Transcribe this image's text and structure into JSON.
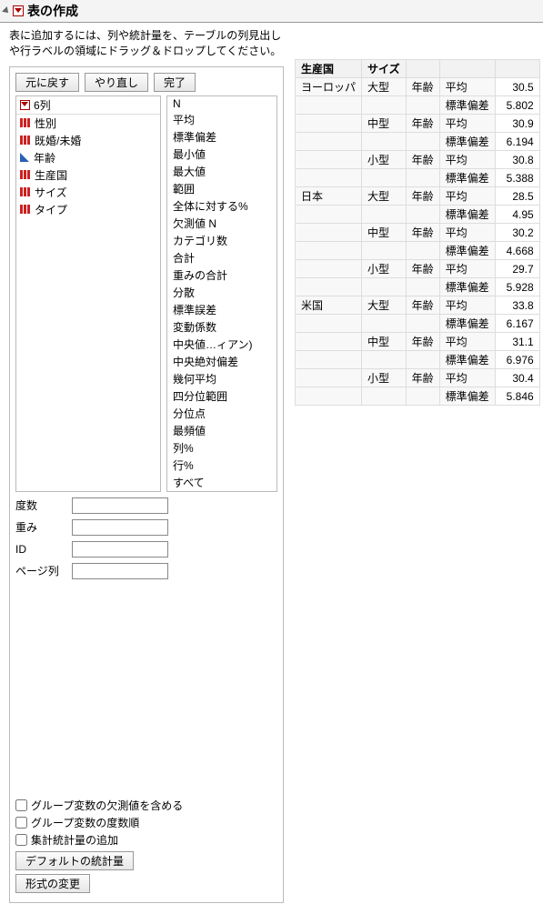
{
  "title": "表の作成",
  "instruction": "表に追加するには、列や統計量を、テーブルの列見出しや行ラベルの領域にドラッグ＆ドロップしてください。",
  "buttons": {
    "undo": "元に戻す",
    "redo": "やり直し",
    "done": "完了"
  },
  "col_count_label": "6列",
  "columns": [
    {
      "name": "性別",
      "type": "nom"
    },
    {
      "name": "既婚/未婚",
      "type": "nom"
    },
    {
      "name": "年齢",
      "type": "cont"
    },
    {
      "name": "生産国",
      "type": "nom"
    },
    {
      "name": "サイズ",
      "type": "nom"
    },
    {
      "name": "タイプ",
      "type": "nom"
    }
  ],
  "stats": [
    "N",
    "平均",
    "標準偏差",
    "最小値",
    "最大値",
    "範囲",
    "全体に対する%",
    "欠測値 N",
    "カテゴリ数",
    "合計",
    "重みの合計",
    "分散",
    "標準誤差",
    "変動係数",
    "中央値…ィアン)",
    "中央絶対偏差",
    "幾何平均",
    "四分位範囲",
    "分位点",
    "最頻値",
    "列%",
    "行%",
    "すべて"
  ],
  "fields": {
    "freq": "度数",
    "weight": "重み",
    "id": "ID",
    "page": "ページ列"
  },
  "checks": {
    "include_missing": "グループ変数の欠測値を含める",
    "freq_order": "グループ変数の度数順",
    "add_aggregate": "集計統計量の追加"
  },
  "bottom_buttons": {
    "default_stats": "デフォルトの統計量",
    "change_format": "形式の変更"
  },
  "table": {
    "headers": [
      "生産国",
      "サイズ",
      "",
      "",
      ""
    ],
    "age_label": "年齢",
    "mean_label": "平均",
    "std_label": "標準偏差",
    "rows": [
      [
        "ヨーロッパ",
        "大型",
        30.5,
        5.802
      ],
      [
        "",
        "中型",
        30.9,
        6.194
      ],
      [
        "",
        "小型",
        30.8,
        5.388
      ],
      [
        "日本",
        "大型",
        28.5,
        4.95
      ],
      [
        "",
        "中型",
        30.2,
        4.668
      ],
      [
        "",
        "小型",
        29.7,
        5.928
      ],
      [
        "米国",
        "大型",
        33.8,
        6.167
      ],
      [
        "",
        "中型",
        31.1,
        6.976
      ],
      [
        "",
        "小型",
        30.4,
        5.846
      ]
    ]
  }
}
